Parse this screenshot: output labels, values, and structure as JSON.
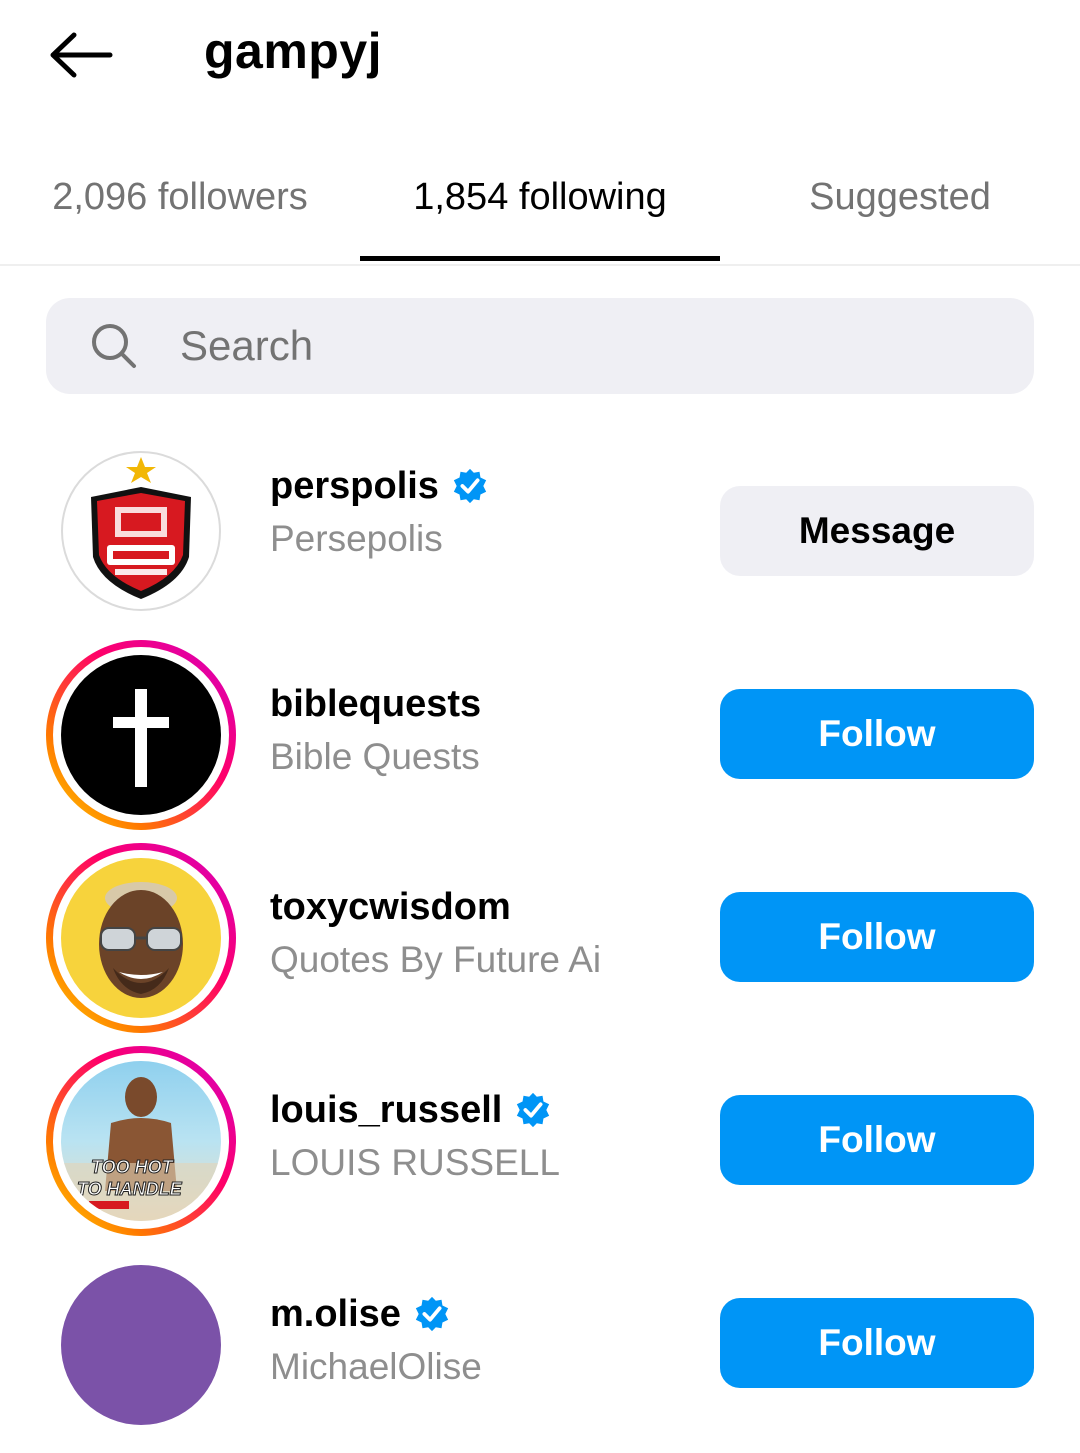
{
  "header": {
    "title": "gampyj",
    "back_icon": "arrow-left-icon"
  },
  "tabs": [
    {
      "label": "2,096 followers",
      "active": false
    },
    {
      "label": "1,854 following",
      "active": true
    },
    {
      "label": "Suggested",
      "active": false
    }
  ],
  "search": {
    "placeholder": "Search",
    "icon": "search-icon"
  },
  "users": [
    {
      "username": "perspolis",
      "full_name": "Persepolis",
      "verified": true,
      "action": "Message",
      "avatar": "persepolis-logo",
      "story_ring": false
    },
    {
      "username": "biblequests",
      "full_name": "Bible Quests",
      "verified": false,
      "action": "Follow",
      "avatar": "cross-icon",
      "story_ring": true
    },
    {
      "username": "toxycwisdom",
      "full_name": "Quotes By Future Ai",
      "verified": false,
      "action": "Follow",
      "avatar": "face-photo",
      "story_ring": true
    },
    {
      "username": "louis_russell",
      "full_name": "LOUIS RUSSELL",
      "verified": true,
      "action": "Follow",
      "avatar": "beach-photo",
      "story_ring": true,
      "avatar_caption": [
        "TOO HOT",
        "TO HANDLE"
      ]
    },
    {
      "username": "m.olise",
      "full_name": "MichaelOlise",
      "verified": true,
      "action": "Follow",
      "avatar": "purple-circle",
      "story_ring": false
    }
  ],
  "colors": {
    "follow_button": "#0095f6",
    "message_button": "#efeff4",
    "verified_badge": "#0095f6",
    "secondary_text": "#8e8e8e"
  }
}
